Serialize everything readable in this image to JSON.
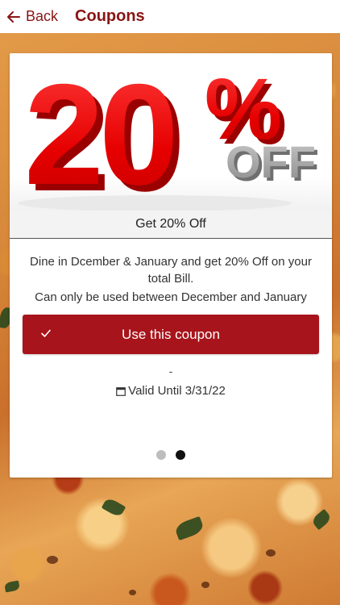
{
  "header": {
    "back_label": "Back",
    "title": "Coupons"
  },
  "coupon": {
    "image": {
      "big_text": "20",
      "percent": "%",
      "off_text": "OFF"
    },
    "name": "Get 20% Off",
    "description": "Dine in Dcember & January  and get 20% Off on your total Bill.",
    "restriction": "Can only be used between December and January",
    "button_label": "Use this coupon",
    "separator": "-",
    "valid_until": "Valid Until 3/31/22"
  },
  "pager": {
    "total": 2,
    "active_index": 1
  },
  "colors": {
    "brand": "#8a1515",
    "button": "#a8141b"
  }
}
